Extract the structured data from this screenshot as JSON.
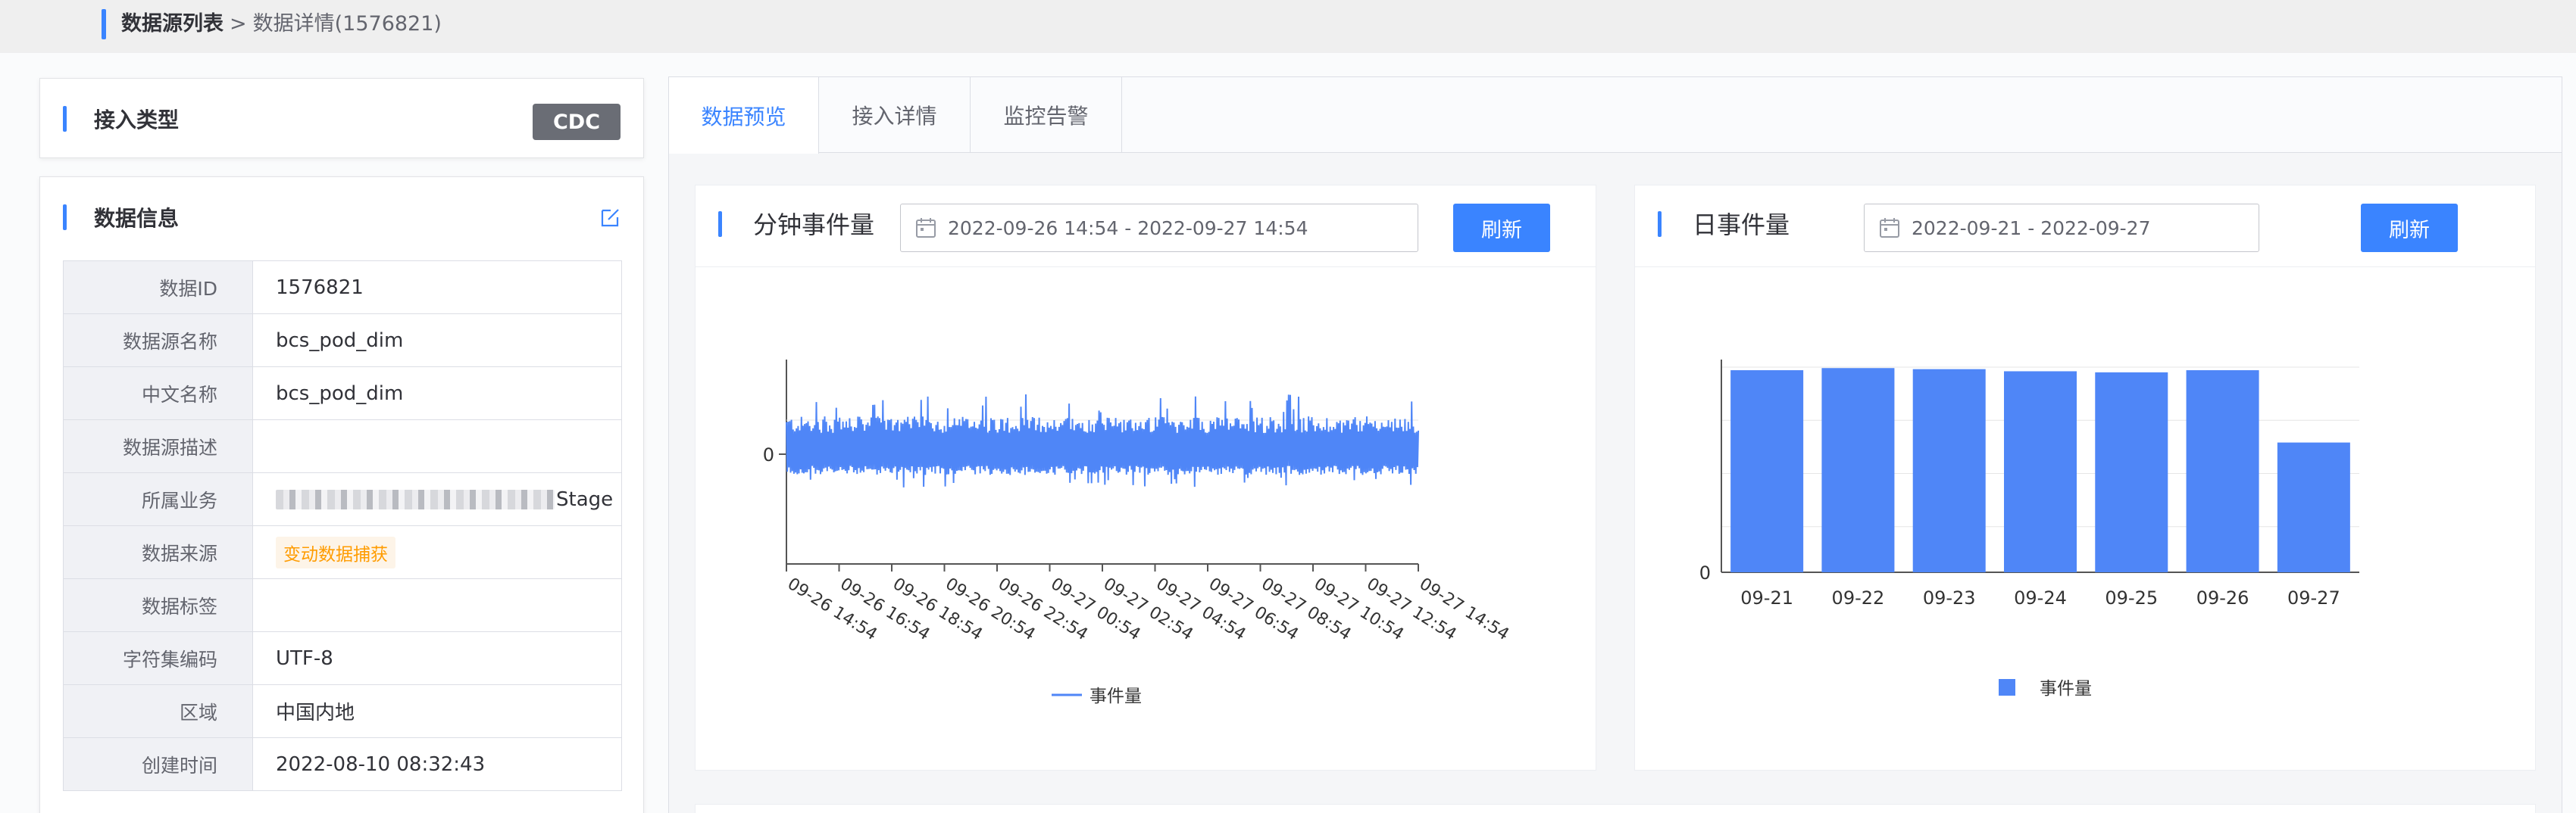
{
  "breadcrumb": {
    "root": "数据源列表",
    "separator": ">",
    "current": "数据详情(1576821)"
  },
  "access_card": {
    "title": "接入类型",
    "tag": "CDC"
  },
  "info_card": {
    "title": "数据信息",
    "rows": [
      {
        "key": "数据ID",
        "value": "1576821"
      },
      {
        "key": "数据源名称",
        "value": "bcs_pod_dim"
      },
      {
        "key": "中文名称",
        "value": "bcs_pod_dim"
      },
      {
        "key": "数据源描述",
        "value": ""
      },
      {
        "key": "所属业务",
        "value": "Stage"
      },
      {
        "key": "数据来源",
        "value": "变动数据捕获"
      },
      {
        "key": "数据标签",
        "value": ""
      },
      {
        "key": "字符集编码",
        "value": "UTF-8"
      },
      {
        "key": "区域",
        "value": "中国内地"
      },
      {
        "key": "创建时间",
        "value": "2022-08-10 08:32:43"
      }
    ]
  },
  "tabs": [
    {
      "label": "数据预览",
      "active": true
    },
    {
      "label": "接入详情",
      "active": false
    },
    {
      "label": "监控告警",
      "active": false
    }
  ],
  "minute_panel": {
    "title": "分钟事件量",
    "date_range": "2022-09-26 14:54 - 2022-09-27 14:54",
    "refresh_label": "刷新"
  },
  "day_panel": {
    "title": "日事件量",
    "date_range": "2022-09-21 - 2022-09-27",
    "refresh_label": "刷新"
  },
  "colors": {
    "accent": "#3a84ff",
    "series": "#4f86f7",
    "tag_bg": "#6a6d75",
    "source_tag": "#ff9c01"
  },
  "chart_data": [
    {
      "type": "line",
      "legend_position": "bottom",
      "series": [
        {
          "name": "事件量"
        }
      ],
      "y_tick_labels": [
        "0"
      ],
      "x_tick_labels": [
        "09-26 14:54",
        "09-26 16:54",
        "09-26 18:54",
        "09-26 20:54",
        "09-26 22:54",
        "09-27 00:54",
        "09-27 02:54",
        "09-27 04:54",
        "09-27 06:54",
        "09-27 08:54",
        "09-27 10:54",
        "09-27 12:54",
        "09-27 14:54"
      ]
    },
    {
      "type": "bar",
      "legend_position": "bottom",
      "categories": [
        "09-21",
        "09-22",
        "09-23",
        "09-24",
        "09-25",
        "09-26",
        "09-27"
      ],
      "series": [
        {
          "name": "事件量",
          "values": [
            0.95,
            0.96,
            0.955,
            0.945,
            0.94,
            0.95,
            0.61
          ]
        }
      ],
      "y_tick_labels": [
        "0"
      ],
      "ylim": [
        0,
        1
      ]
    }
  ]
}
